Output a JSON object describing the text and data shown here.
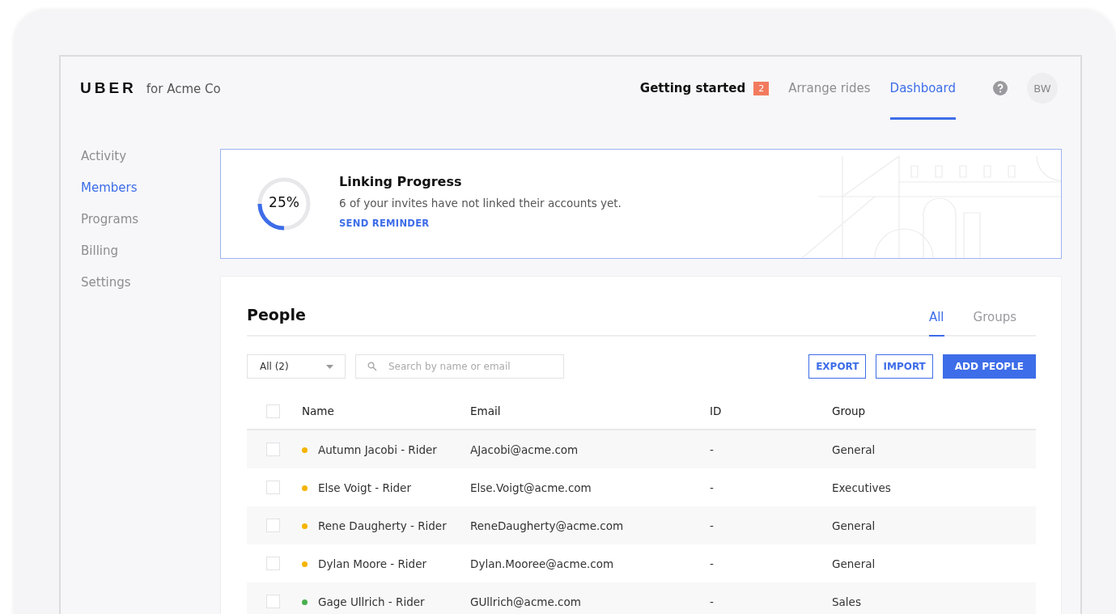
{
  "brand": {
    "logo": "UBER",
    "company": "for Acme Co"
  },
  "nav": [
    {
      "label": "Getting started",
      "selected": false,
      "badge": "2",
      "kind": "primary"
    },
    {
      "label": "Arrange rides",
      "selected": false,
      "kind": "plain"
    },
    {
      "label": "Dashboard",
      "selected": true,
      "kind": "plain"
    }
  ],
  "user": {
    "initials": "BW"
  },
  "sidebar": {
    "items": [
      {
        "label": "Activity",
        "selected": false
      },
      {
        "label": "Members",
        "selected": true
      },
      {
        "label": "Programs",
        "selected": false
      },
      {
        "label": "Billing",
        "selected": false
      },
      {
        "label": "Settings",
        "selected": false
      }
    ]
  },
  "progress": {
    "level": 0.25,
    "reading": "25%",
    "title": "Linking Progress",
    "text": "6 of your invites have not linked their accounts yet.",
    "link": "SEND REMINDER"
  },
  "people": {
    "title": "People",
    "tabs": [
      {
        "label": "All",
        "selected": true
      },
      {
        "label": "Groups",
        "selected": false
      }
    ],
    "filter": {
      "value": "All (2)"
    },
    "search": {
      "placeholder": "Search by name or email"
    },
    "buttons": [
      {
        "label": "EXPORT",
        "kind": "outline"
      },
      {
        "label": "IMPORT",
        "kind": "outline"
      },
      {
        "label": "ADD PEOPLE",
        "kind": "solid"
      }
    ],
    "columns": [
      "Name",
      "Email",
      "ID",
      "Group"
    ],
    "header_checked": false,
    "rows": [
      {
        "name": "Autumn Jacobi - Rider",
        "email": "AJacobi@acme.com",
        "id": "-",
        "group": "General",
        "color": "#f5b400",
        "checked": false
      },
      {
        "name": "Else Voigt - Rider",
        "email": "Else.Voigt@acme.com",
        "id": "-",
        "group": "Executives",
        "color": "#f5b400",
        "checked": false
      },
      {
        "name": "Rene Daugherty - Rider",
        "email": "ReneDaugherty@acme.com",
        "id": "-",
        "group": "General",
        "color": "#f5b400",
        "checked": false
      },
      {
        "name": "Dylan Moore - Rider",
        "email": "Dylan.Mooree@acme.com",
        "id": "-",
        "group": "General",
        "color": "#f5b400",
        "checked": false
      },
      {
        "name": "Gage Ullrich - Rider",
        "email": "GUllrich@acme.com",
        "id": "-",
        "group": "Sales",
        "color": "#4caf50",
        "checked": false
      }
    ]
  }
}
